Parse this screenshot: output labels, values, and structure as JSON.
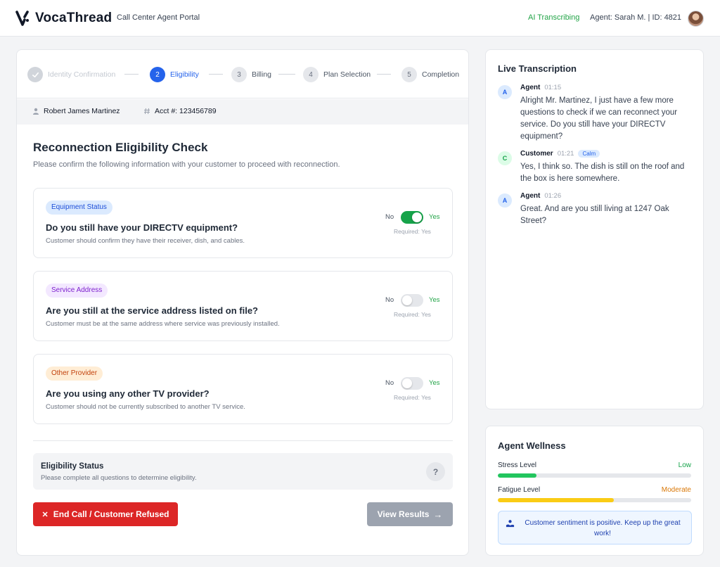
{
  "header": {
    "brand": "VocaThread",
    "portal": "Call Center Agent Portal",
    "ai_status": "AI Transcribing",
    "agent_info": "Agent: Sarah M. | ID: 4821"
  },
  "stepper": {
    "steps": [
      {
        "number": "1",
        "label": "Identity Confirmation",
        "state": "done"
      },
      {
        "number": "2",
        "label": "Eligibility",
        "state": "active"
      },
      {
        "number": "3",
        "label": "Billing",
        "state": "pending"
      },
      {
        "number": "4",
        "label": "Plan Selection",
        "state": "pending"
      },
      {
        "number": "5",
        "label": "Completion",
        "state": "pending"
      }
    ]
  },
  "customer": {
    "name": "Robert James Martinez",
    "account": "Acct #: 123456789"
  },
  "page": {
    "title": "Reconnection Eligibility Check",
    "description": "Please confirm the following information with your customer to proceed with reconnection."
  },
  "questions": [
    {
      "badge": "Equipment Status",
      "title": "Do you still have your DIRECTV equipment?",
      "description": "Customer should confirm they have their receiver, dish, and cables.",
      "no_label": "No",
      "yes_label": "Yes",
      "required": "Required: Yes",
      "answer_yes": true
    },
    {
      "badge": "Service Address",
      "title": "Are you still at the service address listed on file?",
      "description": "Customer must be at the same address where service was previously installed.",
      "no_label": "No",
      "yes_label": "Yes",
      "required": "Required: Yes",
      "answer_yes": false
    },
    {
      "badge": "Other Provider",
      "title": "Are you using any other TV provider?",
      "description": "Customer should not be currently subscribed to another TV service.",
      "no_label": "No",
      "yes_label": "Yes",
      "required": "Required: Yes",
      "answer_yes": false
    }
  ],
  "eligibility": {
    "title": "Eligibility Status",
    "description": "Please complete all questions to determine eligibility.",
    "help": "?"
  },
  "actions": {
    "end_call": "End Call / Customer Refused",
    "view_results": "View Results"
  },
  "transcription": {
    "title": "Live Transcription",
    "messages": [
      {
        "initial": "A",
        "speaker": "Agent",
        "time": "01:15",
        "text": "Alright Mr. Martinez, I just have a few more questions to check if we can reconnect your service. Do you still have your DIRECTV equipment?"
      },
      {
        "initial": "C",
        "speaker": "Customer",
        "time": "01:21",
        "tag": "Calm",
        "text": "Yes, I think so. The dish is still on the roof and the box is here somewhere."
      },
      {
        "initial": "A",
        "speaker": "Agent",
        "time": "01:26",
        "text": "Great. And are you still living at 1247 Oak Street?"
      }
    ]
  },
  "wellness": {
    "title": "Agent Wellness",
    "stress": {
      "label": "Stress Level",
      "value": "Low",
      "level": 0.2,
      "color": "#22c55e"
    },
    "fatigue": {
      "label": "Fatigue Level",
      "value": "Moderate",
      "level": 0.6,
      "color": "#facc15"
    },
    "sentiment": "Customer sentiment is positive. Keep up the great work!"
  },
  "colors": {
    "primary": "#2563eb",
    "success": "#16a34a",
    "danger": "#dc2626",
    "warning": "#d97706",
    "badge_equipment_bg": "#dbeafe",
    "badge_equipment_fg": "#1d4ed8",
    "badge_address_bg": "#f3e8ff",
    "badge_address_fg": "#7e22ce",
    "badge_provider_bg": "#ffedd5",
    "badge_provider_fg": "#c2410c"
  }
}
